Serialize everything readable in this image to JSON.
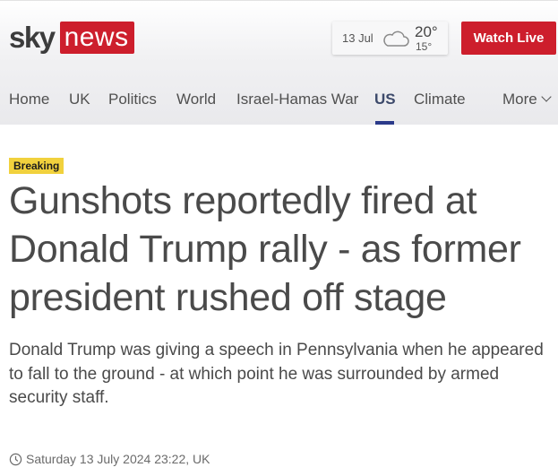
{
  "header": {
    "logo": {
      "sky": "sky",
      "news": "news"
    },
    "weather": {
      "date": "13 Jul",
      "high": "20°",
      "low": "15°",
      "icon": "cloud-icon"
    },
    "watch_live_label": "Watch Live",
    "brand_color": "#cd1e2c"
  },
  "nav": {
    "items": [
      {
        "label": "Home"
      },
      {
        "label": "UK"
      },
      {
        "label": "Politics"
      },
      {
        "label": "World"
      },
      {
        "label": "Israel-Hamas War"
      },
      {
        "label": "US",
        "active": true
      },
      {
        "label": "Climate"
      }
    ],
    "more_label": "More",
    "active_color": "#2b3a8a"
  },
  "article": {
    "badge": "Breaking",
    "badge_color": "#f1d13d",
    "headline": "Gunshots reportedly fired at Donald Trump rally - as former president rushed off stage",
    "standfirst": "Donald Trump was giving a speech in Pennsylvania when he appeared to fall to the ground - at which point he was surrounded by armed security staff.",
    "dateline": "Saturday 13 July 2024 23:22, UK",
    "dateline_icon": "clock-icon"
  }
}
